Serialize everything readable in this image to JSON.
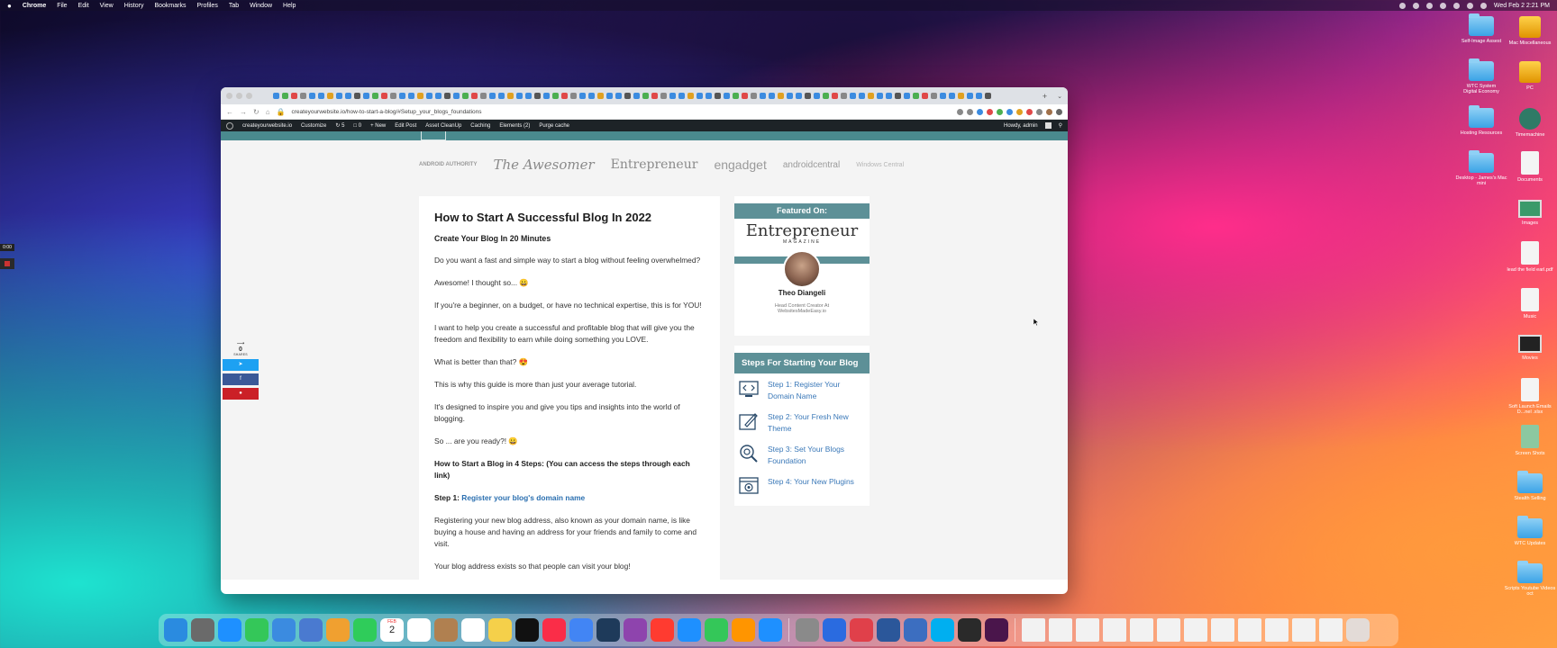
{
  "menubar": {
    "app": "Chrome",
    "items": [
      "File",
      "Edit",
      "View",
      "History",
      "Bookmarks",
      "Profiles",
      "Tab",
      "Window",
      "Help"
    ],
    "datetime": "Wed Feb 2  2:21 PM"
  },
  "widget": {
    "timer": "0:00"
  },
  "browser": {
    "url": "createyourwebsite.io/how-to-start-a-blog/#Setup_your_blogs_foundations",
    "tab_favicon_colors": [
      "#3b8be0",
      "#4caf50",
      "#e04848",
      "#888888",
      "#3b8be0",
      "#3b8be0",
      "#e0a020",
      "#3b8be0",
      "#3b8be0",
      "#555555"
    ]
  },
  "wpbar": {
    "site": "createyourwebsite.io",
    "customize": "Customize",
    "updates": "5",
    "comments": "0",
    "new": "+ New",
    "edit_post": "Edit Post",
    "asset_cleanup": "Asset CleanUp",
    "caching": "Caching",
    "elements": "Elements (2)",
    "purge": "Purge cache",
    "howdy": "Howdy, admin"
  },
  "logos": {
    "android_authority": "ANDROID AUTHORITY",
    "awesomer": "The Awesomer",
    "entrepreneur": "Entrepreneur",
    "engadget": "engadget",
    "androidcentral": "androidcentral",
    "windows_central": "Windows Central"
  },
  "share": {
    "count": "0",
    "label": "SHARES"
  },
  "article": {
    "title": "How to Start A Successful Blog In 2022",
    "subtitle": "Create Your Blog In 20 Minutes",
    "p1": "Do you want a fast and simple way to start a blog without feeling overwhelmed?",
    "p2": "Awesome! I thought so... 😀",
    "p3": "If you're a beginner, on a budget, or have no technical expertise, this is for YOU!",
    "p4": "I want to help you create a successful and profitable blog that will give you the freedom and flexibility to earn while doing something you LOVE.",
    "p5": "What is better than that? 😍",
    "p6": "This is why this guide is more than just your average tutorial.",
    "p7": "It's designed to inspire you and give you tips and insights into the world of blogging.",
    "p8": "So ... are you ready?! 😀",
    "p9": "How to Start a Blog in 4 Steps: (You can access the steps through each link)",
    "step1_prefix": "Step 1:",
    "step1_link": "Register your blog's domain name",
    "p10": "Registering your new blog address, also known as your domain name, is like buying a house and having an address for your friends and family to come and visit.",
    "p11": "Your blog address exists so that people can visit your blog!"
  },
  "featured": {
    "heading": "Featured On:",
    "magazine": "Entrepreneur",
    "magazine_sub": "MAGAZINE",
    "name": "Theo Diangeli",
    "role": "Head Content Creator At",
    "site": "WebsitesMadeEasy.io"
  },
  "steps": {
    "heading": "Steps For Starting Your Blog",
    "items": [
      {
        "label": "Step 1: Register Your Domain Name",
        "icon": "code-window-icon"
      },
      {
        "label": "Step 2: Your Fresh New Theme",
        "icon": "pen-edit-icon"
      },
      {
        "label": "Step 3: Set Your Blogs Foundation",
        "icon": "magnifier-gear-icon"
      },
      {
        "label": "Step 4: Your New Plugins",
        "icon": "plugin-window-icon"
      }
    ]
  },
  "desktop": {
    "self_image": "Self-Image Assest",
    "mac_misc": "Mac Miscellaneous",
    "wtc_system": "WTC System",
    "digital_economy": "Digital Economy",
    "pc": "PC",
    "hosting": "Hosting Resources",
    "timemachine": "Timemachine",
    "desktop_james": "Desktop - James's Mac mini",
    "documents": "Documents",
    "images": "Images",
    "lead_field": "lead the field earl.pdf",
    "music": "Music",
    "movies": "Movies",
    "soft_launch": "Soft Launch Emails D...nel .xlsx",
    "screen_shots": "Screen Shots",
    "stealth": "Stealth Selling",
    "wtc_updates": "WTC Updates",
    "scripts": "Scripts Youtube Videos oct"
  },
  "dock": {
    "calendar_month": "FEB",
    "calendar_day": "2",
    "app_colors": [
      "#2a8be0",
      "#6a6a6a",
      "#1e90ff",
      "#34c759",
      "#3b8be0",
      "#4a7ad0",
      "#f0a030",
      "#2fcc5a",
      "#ffffff",
      "#b08050",
      "#ffffff",
      "#f5d04a",
      "#111111",
      "#fa2d48",
      "#4285f4",
      "#1e3a5a",
      "#8e44ad",
      "#ff3b30",
      "#1e90ff",
      "#34c759",
      "#ff9500",
      "#1e90ff",
      "#8a8a8a",
      "#2a6be0",
      "#e0404a",
      "#2b579a",
      "#3c6ec0",
      "#00aff0",
      "#2a2a2a",
      "#4a154b"
    ]
  }
}
